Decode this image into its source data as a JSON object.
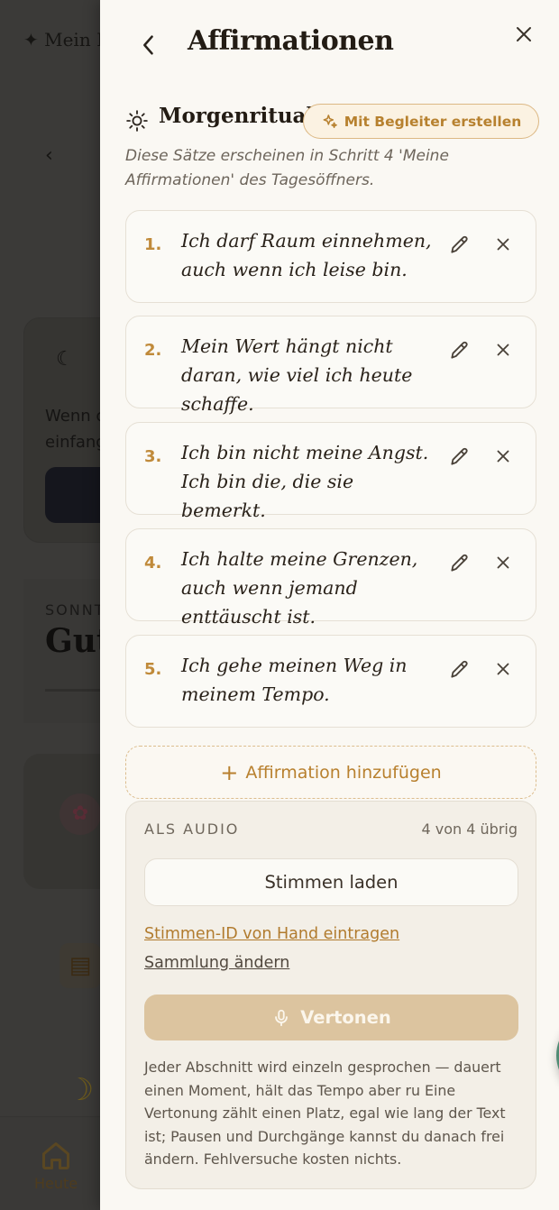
{
  "background": {
    "header": "✦ Mein I",
    "card_text": "Wenn c\neinfang",
    "day_label": "SONNT",
    "greeting": "Gut",
    "nav": {
      "home_label": "Heute"
    }
  },
  "sheet": {
    "title": "Affirmationen",
    "section": {
      "title": "Morgenritual",
      "companion_button": "Mit Begleiter erstellen",
      "description": "Diese Sätze erscheinen in Schritt 4 'Meine Affirmationen' des Tagesöffners."
    },
    "affirmations": [
      {
        "number": "1.",
        "text": "Ich darf Raum einnehmen, auch wenn ich leise bin."
      },
      {
        "number": "2.",
        "text": "Mein Wert hängt nicht daran, wie viel ich heute schaffe."
      },
      {
        "number": "3.",
        "text": "Ich bin nicht meine Angst. Ich bin die, die sie bemerkt."
      },
      {
        "number": "4.",
        "text": "Ich halte meine Grenzen, auch wenn jemand enttäuscht ist."
      },
      {
        "number": "5.",
        "text": "Ich gehe meinen Weg in meinem Tempo."
      }
    ],
    "add_button": "Affirmation hinzufügen",
    "audio": {
      "label": "ALS AUDIO",
      "remaining": "4 von 4 übrig",
      "load_voices": "Stimmen laden",
      "manual_voice_id": "Stimmen-ID von Hand eintragen",
      "change_collection": "Sammlung ändern",
      "voice_button": "Vertonen",
      "note": "Jeder Abschnitt wird einzeln gesprochen — dauert einen Moment, hält das Tempo aber ru Eine Vertonung zählt einen Platz, egal wie lang der Text ist; Pausen und Durchgänge kannst du danach frei ändern. Fehlversuche kosten nichts."
    }
  },
  "colors": {
    "accent": "#c08a3a",
    "fab": "#4f8b73",
    "voice_button": "#dcc49f"
  },
  "icons": [
    "chevron-left-icon",
    "close-icon",
    "sun-icon",
    "sparkle-icon",
    "pencil-icon",
    "x-icon",
    "plus-icon",
    "microphone-icon",
    "lifebuoy-icon",
    "home-icon",
    "moon-icon"
  ]
}
